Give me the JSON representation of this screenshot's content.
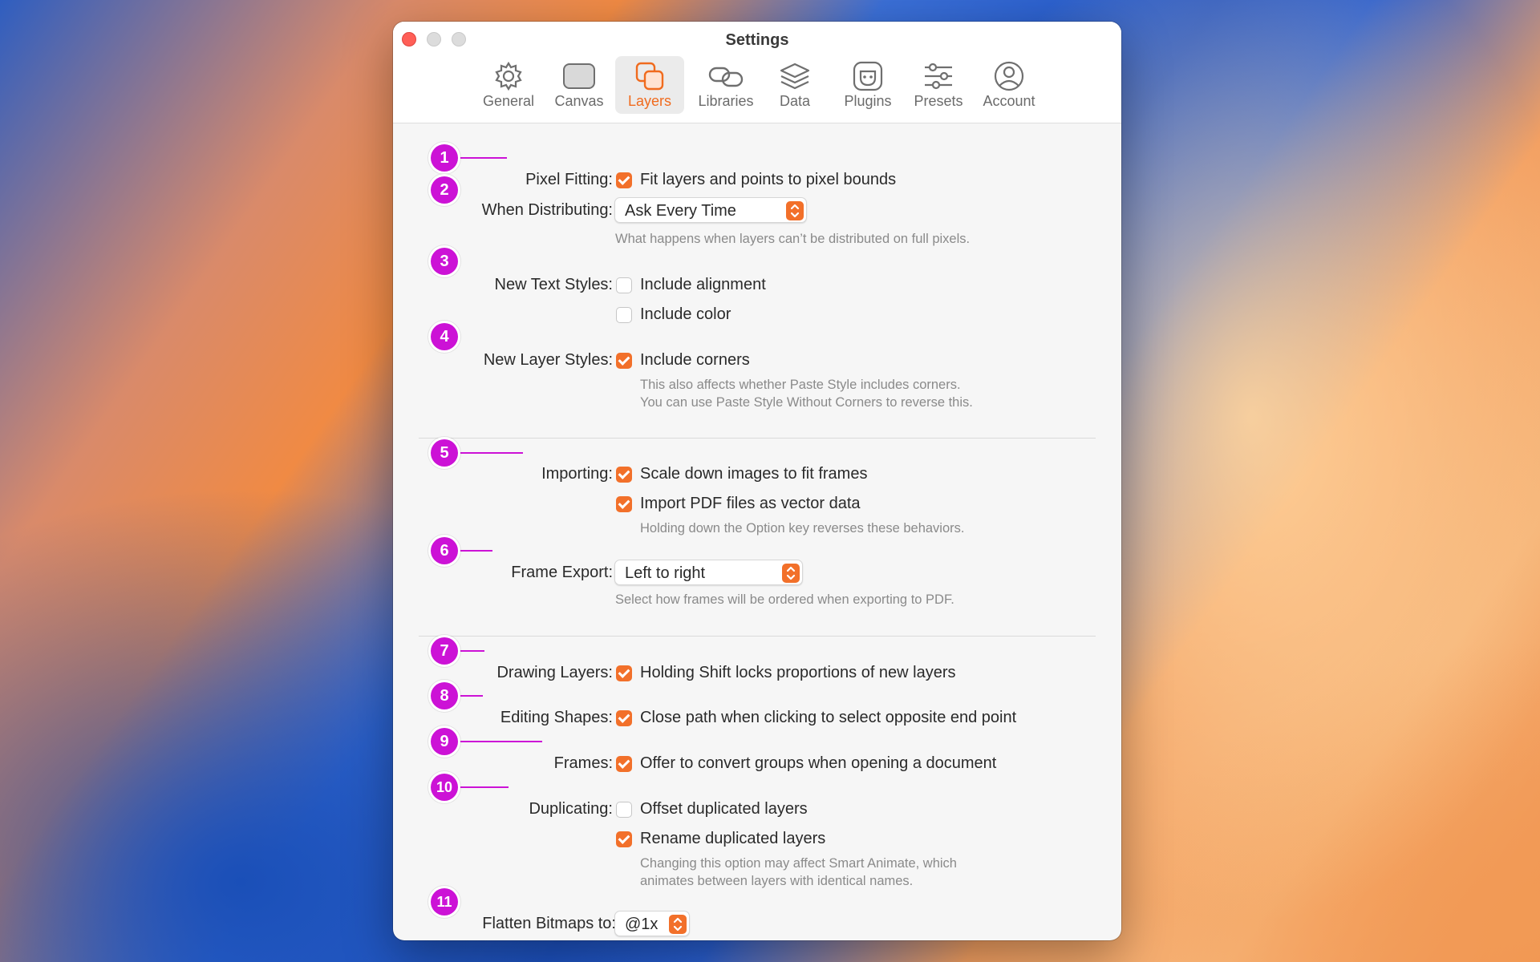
{
  "window": {
    "title": "Settings"
  },
  "toolbar": {
    "tabs": [
      {
        "label": "General",
        "icon": "gear-icon"
      },
      {
        "label": "Canvas",
        "icon": "canvas-icon"
      },
      {
        "label": "Layers",
        "icon": "layers-icon",
        "active": true
      },
      {
        "label": "Libraries",
        "icon": "link-icon"
      },
      {
        "label": "Data",
        "icon": "stack-icon"
      },
      {
        "label": "Plugins",
        "icon": "plug-icon"
      },
      {
        "label": "Presets",
        "icon": "sliders-icon"
      },
      {
        "label": "Account",
        "icon": "person-circle-icon"
      }
    ]
  },
  "settings": {
    "pixel_fitting": {
      "label": "Pixel Fitting:",
      "option": "Fit layers and points to pixel bounds",
      "checked": true
    },
    "distributing": {
      "label": "When Distributing:",
      "value": "Ask Every Time",
      "help": "What happens when layers can’t be distributed on full pixels."
    },
    "text_styles": {
      "label": "New Text Styles:",
      "options": [
        {
          "text": "Include alignment",
          "checked": false
        },
        {
          "text": "Include color",
          "checked": false
        }
      ]
    },
    "layer_styles": {
      "label": "New Layer Styles:",
      "option": "Include corners",
      "checked": true,
      "help1": "This also affects whether Paste Style includes corners.",
      "help2": "You can use Paste Style Without Corners to reverse this."
    },
    "importing": {
      "label": "Importing:",
      "options": [
        {
          "text": "Scale down images to fit frames",
          "checked": true
        },
        {
          "text": "Import PDF files as vector data",
          "checked": true
        }
      ],
      "help": "Holding down the Option key reverses these behaviors."
    },
    "frame_export": {
      "label": "Frame Export:",
      "value": "Left to right",
      "help": "Select how frames will be ordered when exporting to PDF."
    },
    "drawing_layers": {
      "label": "Drawing Layers:",
      "option": "Holding Shift locks proportions of new layers",
      "checked": true
    },
    "editing_shapes": {
      "label": "Editing Shapes:",
      "option": "Close path when clicking to select opposite end point",
      "checked": true
    },
    "frames": {
      "label": "Frames:",
      "option": "Offer to convert groups when opening a document",
      "checked": true
    },
    "duplicating": {
      "label": "Duplicating:",
      "options": [
        {
          "text": "Offset duplicated layers",
          "checked": false
        },
        {
          "text": "Rename duplicated layers",
          "checked": true
        }
      ],
      "help1": "Changing this option may affect Smart Animate, which",
      "help2": "animates between layers with identical names."
    },
    "flatten": {
      "label": "Flatten Bitmaps to:",
      "value": "@1x"
    }
  },
  "annotations": [
    "1",
    "2",
    "3",
    "4",
    "5",
    "6",
    "7",
    "8",
    "9",
    "10",
    "11"
  ],
  "colors": {
    "accent": "#f2702a",
    "annotation": "#cc12d6",
    "close": "#ff5f57"
  }
}
